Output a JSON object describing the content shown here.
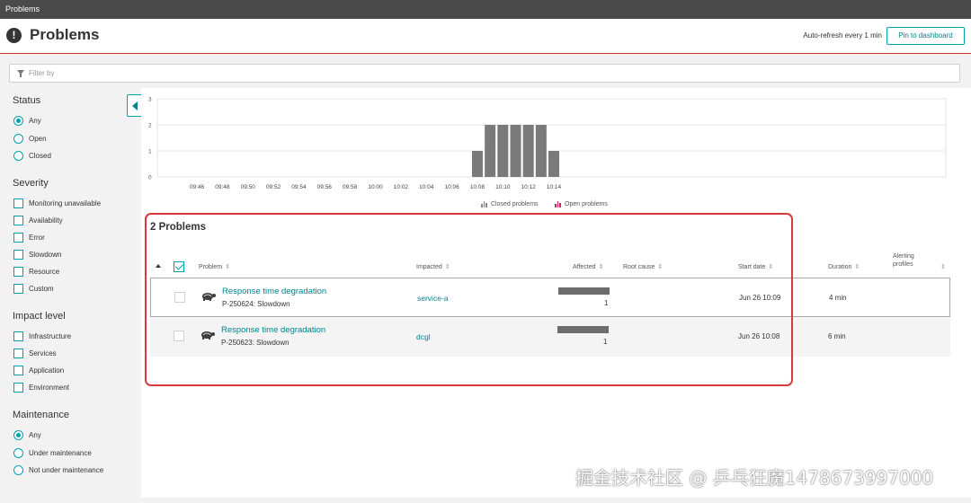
{
  "window": {
    "title": "Problems"
  },
  "header": {
    "title": "Problems",
    "auto_refresh": "Auto-refresh every 1 min",
    "pin_label": "Pin to dashboard"
  },
  "filter": {
    "placeholder": "Filter by"
  },
  "sidebar": {
    "status": {
      "title": "Status",
      "options": [
        "Any",
        "Open",
        "Closed"
      ],
      "selected": "Any"
    },
    "severity": {
      "title": "Severity",
      "options": [
        "Monitoring unavailable",
        "Availability",
        "Error",
        "Slowdown",
        "Resource",
        "Custom"
      ]
    },
    "impact": {
      "title": "Impact level",
      "options": [
        "Infrastructure",
        "Services",
        "Application",
        "Environment"
      ]
    },
    "maintenance": {
      "title": "Maintenance",
      "options": [
        "Any",
        "Under maintenance",
        "Not under maintenance"
      ],
      "selected": "Any"
    }
  },
  "chart_data": {
    "type": "bar",
    "categories": [
      "09:46",
      "09:48",
      "09:50",
      "09:52",
      "09:54",
      "09:56",
      "09:58",
      "10:00",
      "10:02",
      "10:04",
      "10:06",
      "10:08",
      "10:10",
      "10:12",
      "10:14"
    ],
    "x": [
      "10:08",
      "10:09",
      "10:10",
      "10:11",
      "10:12",
      "10:13",
      "10:14"
    ],
    "series": [
      {
        "name": "Closed problems",
        "values": [
          0,
          0,
          0,
          0,
          0,
          0,
          0
        ]
      },
      {
        "name": "Open problems",
        "values": [
          1,
          2,
          2,
          2,
          2,
          2,
          1
        ]
      }
    ],
    "ylim": [
      0,
      3
    ],
    "yticks": [
      0,
      1,
      2,
      3
    ],
    "grid": true,
    "legend": "bottom-center",
    "colors": {
      "bars": "#7a7a7a",
      "closed_marker": "#888888",
      "open_marker": "#c9265a"
    }
  },
  "problems": {
    "count_label": "2 Problems",
    "columns": {
      "problem": "Problem",
      "impacted": "Impacted",
      "affected": "Affected",
      "root_cause": "Root cause",
      "start_date": "Start date",
      "duration": "Duration",
      "alerting": "Alerting profiles"
    },
    "rows": [
      {
        "title": "Response time degradation",
        "id": "P-250624: Slowdown",
        "impacted": "service-a",
        "affected": "1",
        "affected_fill": 1.0,
        "start": "Jun 26 10:09",
        "duration": "4 min"
      },
      {
        "title": "Response time degradation",
        "id": "P-250623: Slowdown",
        "impacted": "dcgl",
        "affected": "1",
        "affected_fill": 1.0,
        "start": "Jun 26 10:08",
        "duration": "6 min"
      }
    ]
  },
  "colors": {
    "accent": "#00a1b2",
    "link": "#00848f",
    "error": "#d12f2f"
  },
  "watermark": "掘金技术社区 @ 乒乓狂魔1478673997000"
}
